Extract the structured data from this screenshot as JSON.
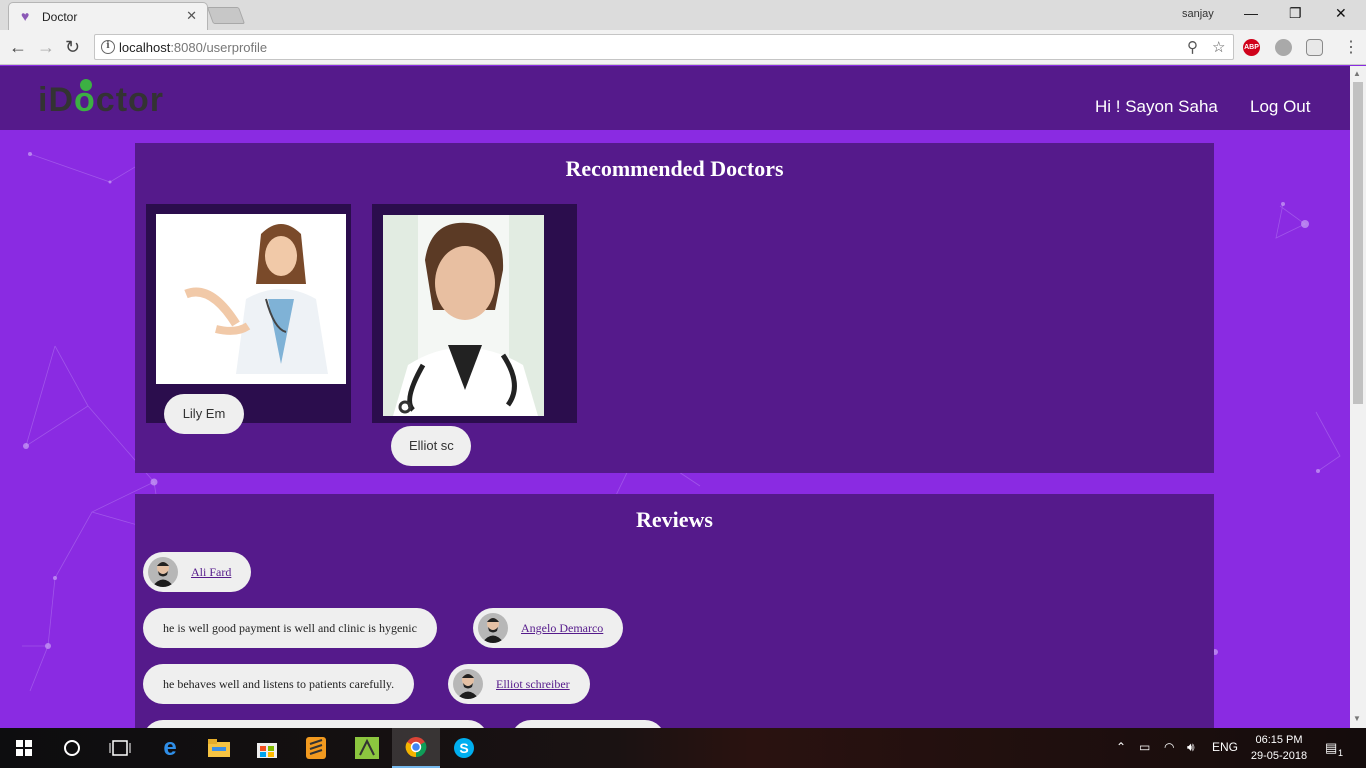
{
  "browser": {
    "tab_title": "Doctor",
    "tab_close": "✕",
    "profile_name": "sanjay",
    "url_host": "localhost",
    "url_rest": ":8080/userprofile",
    "ext_abp": "ABP"
  },
  "navbar": {
    "logo_prefix": "iD",
    "logo_o": "o",
    "logo_suffix": "ctor",
    "greeting": "Hi ! Sayon Saha",
    "logout_label": "Log Out"
  },
  "recommended": {
    "title": "Recommended Doctors",
    "doctors": [
      {
        "name": "Lily Em"
      },
      {
        "name": "Elliot sc"
      }
    ]
  },
  "reviews": {
    "title": "Reviews",
    "items": [
      {
        "comment": "",
        "author": "Ali Fard"
      },
      {
        "comment": "he is well good payment is well and clinic is hygenic",
        "author": "Angelo Demarco"
      },
      {
        "comment": "he behaves well and listens to patients carefully.",
        "author": "Elliot schreiber"
      }
    ]
  },
  "taskbar": {
    "time": "06:15 PM",
    "date": "29-05-2018",
    "language": "ENG",
    "notification_count": "1"
  },
  "colors": {
    "page_bg": "#8a2be2",
    "panel_bg": "#551a8b",
    "card_bg": "#2b0d4d",
    "logo_green": "#3cb043"
  }
}
